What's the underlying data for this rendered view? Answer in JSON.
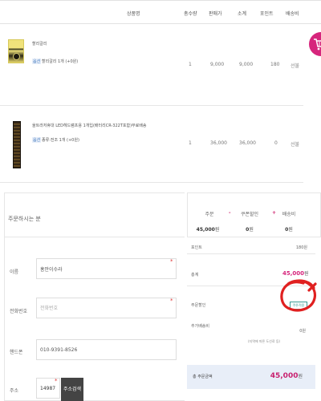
{
  "cart_table": {
    "headers": {
      "product": "상품명",
      "quantity": "총수량",
      "unit_price": "판매가",
      "subtotal": "소계",
      "points": "포인트",
      "shipping": "배송비"
    },
    "items": [
      {
        "name": "할리갈리",
        "option_badge": "옵션",
        "option_text": "할리갈리 1개 (+0원)",
        "quantity": "1",
        "unit_price": "9,000",
        "subtotal": "9,000",
        "points": "180",
        "shipping": "선불"
      },
      {
        "name": "울트라저휴대 LED헤드램프용 1개입(배터리CR-322T포함)무료배송",
        "option_badge": "옵션",
        "option_text": "종류:전조 1개 (+0원)",
        "quantity": "1",
        "unit_price": "36,000",
        "subtotal": "36,000",
        "points": "0",
        "shipping": "선불"
      }
    ]
  },
  "orderer": {
    "title": "주문하시는 분",
    "name_label": "이름",
    "name_value": "홍안이수라",
    "phone_label": "전화번호",
    "phone_placeholder": "전화번호",
    "mobile_label": "핸드폰",
    "mobile_value": "010-9391-8526",
    "address_label": "주소",
    "zip_value": "14987",
    "address_button": "주소검색",
    "required_mark": "*"
  },
  "summary": {
    "order_label": "주문",
    "order_value": "45,000",
    "coupon_label": "쿠폰할인",
    "coupon_value": "0",
    "shipping_label": "배송비",
    "shipping_value": "0",
    "won": "원",
    "minus": "-",
    "plus": "+"
  },
  "details": {
    "points_label": "포인트",
    "points_value": "180원",
    "total_label": "총계",
    "total_value": "45,000",
    "total_unit": "원",
    "coupon_label": "주문할인",
    "coupon_button": "쿠폰적용",
    "extra_shipping_label": "추가배송비",
    "extra_shipping_value": "0원",
    "extra_shipping_note": "(지역에 따른 도선료 등)"
  },
  "grand_total": {
    "label": "총 주문금액",
    "value": "45,000",
    "unit": "원"
  },
  "colors": {
    "accent": "#d6257c",
    "coupon_button": "#3a9c95",
    "annotation": "#e02020",
    "grand_total_bg": "#e8eef8"
  }
}
